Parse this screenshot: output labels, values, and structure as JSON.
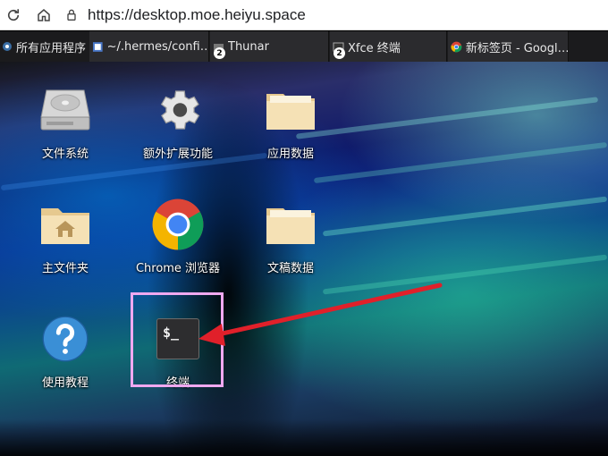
{
  "browser": {
    "url": "https://desktop.moe.heiyu.space"
  },
  "taskbar": {
    "apps_menu": "所有应用程序",
    "tasks": [
      {
        "label": "~/.hermes/confi…",
        "badge": ""
      },
      {
        "label": "Thunar",
        "badge": "2"
      },
      {
        "label": "Xfce 终端",
        "badge": "2"
      },
      {
        "label": "新标签页 - Googl…",
        "badge": ""
      }
    ]
  },
  "desktop": {
    "icons": [
      {
        "label": "文件系统",
        "icon": "drive-harddisk-icon"
      },
      {
        "label": "额外扩展功能",
        "icon": "gear-icon"
      },
      {
        "label": "应用数据",
        "icon": "folder-icon"
      },
      {
        "label": "主文件夹",
        "icon": "home-folder-icon"
      },
      {
        "label": "Chrome 浏览器",
        "icon": "chrome-icon"
      },
      {
        "label": "文稿数据",
        "icon": "folder-icon"
      },
      {
        "label": "使用教程",
        "icon": "help-icon"
      },
      {
        "label": "终端",
        "icon": "terminal-icon"
      }
    ],
    "terminal_glyph": "$_"
  },
  "colors": {
    "highlight": "#f0a8f0",
    "arrow": "#e0202a"
  }
}
